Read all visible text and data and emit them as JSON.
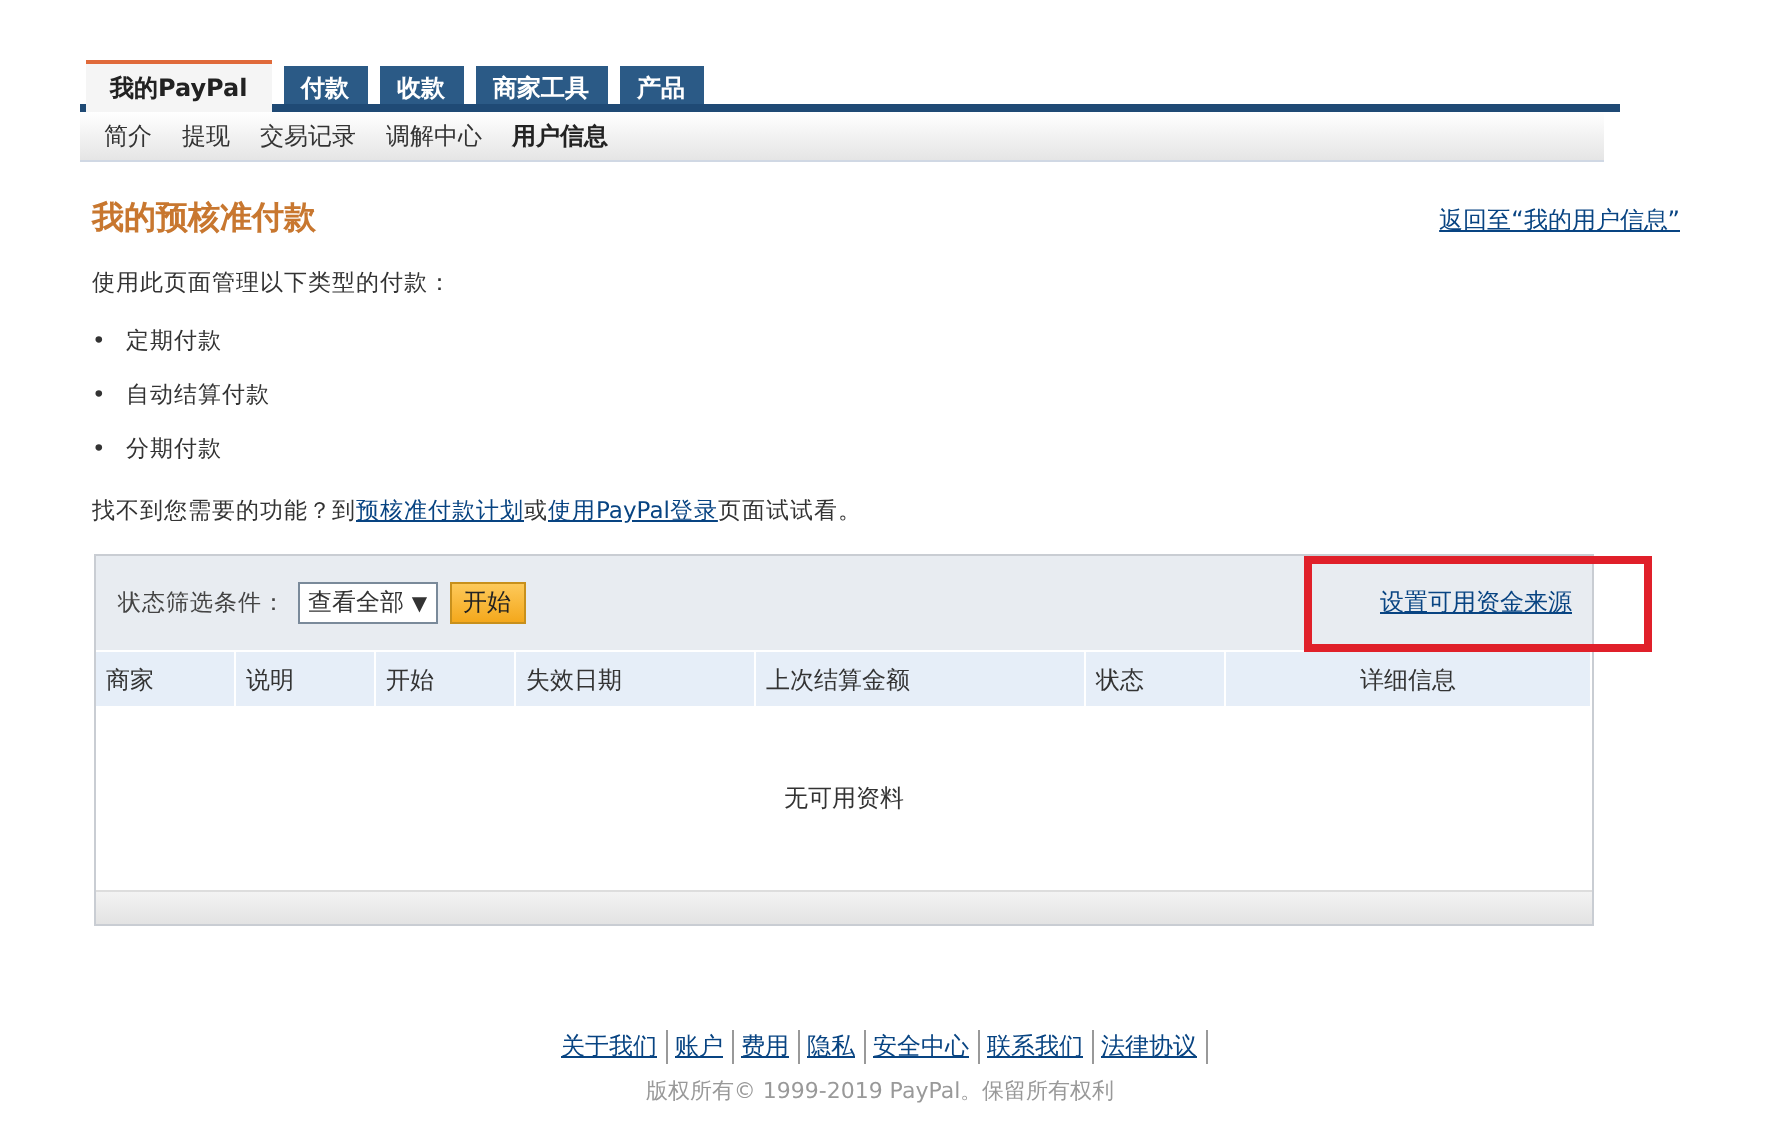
{
  "tabs": [
    {
      "label": "我的PayPal",
      "selected": true
    },
    {
      "label": "付款",
      "selected": false
    },
    {
      "label": "收款",
      "selected": false
    },
    {
      "label": "商家工具",
      "selected": false
    },
    {
      "label": "产品",
      "selected": false
    }
  ],
  "subnav": [
    {
      "label": "简介",
      "selected": false
    },
    {
      "label": "提现",
      "selected": false
    },
    {
      "label": "交易记录",
      "selected": false
    },
    {
      "label": "调解中心",
      "selected": false
    },
    {
      "label": "用户信息",
      "selected": true
    }
  ],
  "page": {
    "title": "我的预核准付款",
    "back_link": "返回至“我的用户信息”",
    "intro": "使用此页面管理以下类型的付款：",
    "types": [
      {
        "bullet": "•",
        "text": "定期付款"
      },
      {
        "bullet": "•",
        "text": "自动结算付款"
      },
      {
        "bullet": "•",
        "text": "分期付款"
      }
    ],
    "help": {
      "before": "找不到您需要的功能？到",
      "link1": "预核准付款计划",
      "middle": "或",
      "link2": "使用PayPal登录",
      "after": "页面试试看。"
    }
  },
  "filter": {
    "label": "状态筛选条件：",
    "select_value": "查看全部",
    "select_arrow": "▼",
    "button": "开始",
    "funding_link": "设置可用资金来源",
    "highlighted": true
  },
  "table": {
    "columns": [
      "商家",
      "说明",
      "开始",
      "失效日期",
      "上次结算金额",
      "状态",
      "详细信息"
    ],
    "empty_message": "无可用资料"
  },
  "footer": {
    "links": [
      "关于我们",
      "账户",
      "费用",
      "隐私",
      "安全中心",
      "联系我们",
      "法律协议"
    ],
    "copyright": "版权所有© 1999-2019 PayPal。保留所有权利"
  }
}
